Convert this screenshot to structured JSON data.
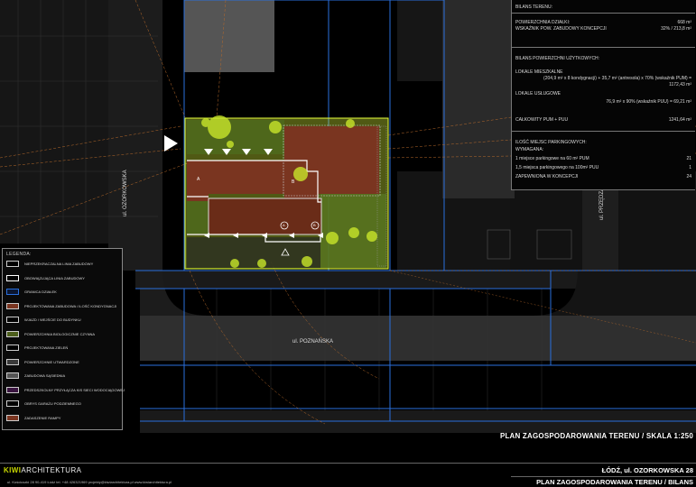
{
  "balance": {
    "heading": "BILANS TERENU:",
    "rows": [
      {
        "label": "POWIERZCHNIA DZIAŁKI:",
        "value": "668 m²"
      },
      {
        "label": "WSKAŹNIK POW. ZABUDOWY KONCEPCJI",
        "value": "32% / 213,8 m²"
      }
    ]
  },
  "usable": {
    "heading": "BILANS POWIERZCHNI UŻYTKOWYCH:",
    "residential_label": "LOKALE MIESZKALNE",
    "residential_formula": "(204,9 m² x 8 kondygnacji) + 35,7 m² (antresola) x 70% (wskaźnik PUM) =",
    "residential_value": "1172,43 m²",
    "service_label": "LOKALE USŁUGOWE",
    "service_formula": "76,9 m² x 90% (wskaźnik PUU) = 69,21 m²",
    "total_label": "CAŁKOWITY PUM + PUU",
    "total_value": "1241,64 m²"
  },
  "parking": {
    "heading": "ILOŚĆ MIEJSC PARKINGOWYCH:",
    "required_label": "WYMAGANA:",
    "rows": [
      {
        "label": "1 miejsce parkingowe na 60 m² PUM",
        "value": "21"
      },
      {
        "label": "1,5 miejsca parkingowego na 100m² PUU",
        "value": "1"
      },
      {
        "label": "ZAPEWNIONA W KONCEPCJI",
        "value": "24"
      }
    ]
  },
  "legend": {
    "title": "LEGENDA:",
    "items": [
      {
        "label": "NIEPRZEKRACZALNA LINIA ZABUDOWY",
        "color": "#000000",
        "border": "#cccccc"
      },
      {
        "label": "OBOWIĄZUJĄCA LINIA ZABUDOWY",
        "color": "#000000",
        "border": "#ffffff"
      },
      {
        "label": "GRANICA DZIAŁEK",
        "color": "#0b1630",
        "border": "#2a6fdc"
      },
      {
        "label": "PROJEKTOWANA ZABUDOWA / ILOŚĆ KONDYGNACJI",
        "color": "#7a3520",
        "border": "#cccccc"
      },
      {
        "label": "WJAZD / WEJŚCIE DO BUDYNKU",
        "color": "#000000",
        "border": "#cccccc"
      },
      {
        "label": "POWIERZCHNIA BIOLOGICZNIE CZYNNA",
        "color": "#4d5f1c",
        "border": "#cccccc"
      },
      {
        "label": "PROJEKTOWANA ZIELEŃ",
        "color": "#000000",
        "border": "#cccccc"
      },
      {
        "label": "POWIERZCHNIE UTWARDZONE",
        "color": "#3a3a3a",
        "border": "#cccccc"
      },
      {
        "label": "ZABUDOWA SĄSIEDNIA",
        "color": "#555555",
        "border": "#cccccc"
      },
      {
        "label": "PRZEDSZKOLNY PRZYŁĄCZA KIS SIECI WODOCIĄGOWEJ",
        "color": "#3a1540",
        "border": "#cccccc"
      },
      {
        "label": "OBRYS GARAŻU PODZIEMNEGO",
        "color": "#000000",
        "border": "#cccccc"
      },
      {
        "label": "ZADASZENIE RAMPY",
        "color": "#7a3520",
        "border": "#cccccc"
      }
    ]
  },
  "streets": {
    "ozorkowska": "ul. OZORKOWSKA",
    "poznanska": "ul. POZNAŃSKA",
    "przedza": "ul. PRZĘDZA"
  },
  "plan_labels": {
    "building_a": "A",
    "building_b": "B",
    "tag_a": "A",
    "tag_b": "B"
  },
  "sheet": {
    "title": "PLAN ZAGOSPODAROWANIA TERENU / SKALA 1:250",
    "brand_prefix": "KIWI",
    "brand_suffix": "ARCHITEKTURA",
    "address": "ul. Kościuszki 28 90-419 Łódź    tel. +48 426321969    projekty@kiwiarchitektura.pl    www.kiwiarchitektura.pl",
    "project": "ŁÓDŹ, ul. OZORKOWSKA 28",
    "subtitle": "PLAN ZAGOSPODAROWANIA TERENU / BILANS"
  },
  "colors": {
    "site_yellow": "#e6ff3a",
    "building": "#7a3520",
    "green": "#4d5f1c",
    "plot_border": "#2a6fdc",
    "neighbour": "#555555"
  }
}
